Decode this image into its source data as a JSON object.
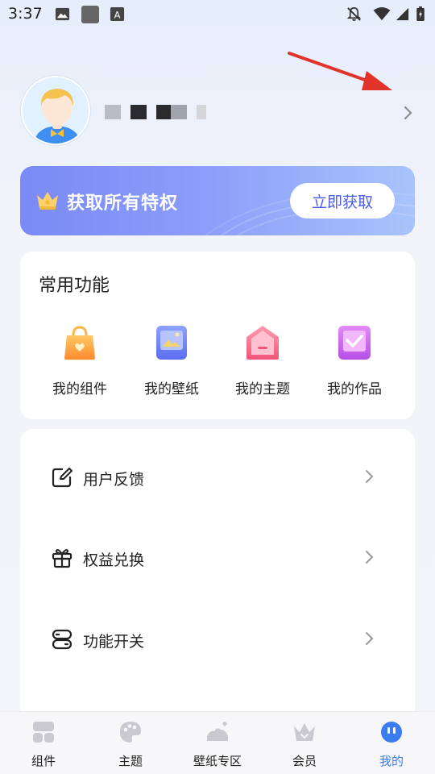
{
  "status_bar": {
    "time": "3:37",
    "left_icons": [
      "image-icon",
      "square-app-icon",
      "font-a-icon"
    ],
    "right_icons": [
      "bell-off-icon",
      "wifi-icon",
      "signal-icon",
      "battery-charging-icon"
    ]
  },
  "profile": {
    "avatar_icon": "avatar-boy-icon"
  },
  "vip": {
    "text": "获取所有特权",
    "button": "立即获取",
    "icon": "crown-icon"
  },
  "common": {
    "title": "常用功能",
    "items": [
      {
        "label": "我的组件",
        "icon": "bag-icon"
      },
      {
        "label": "我的壁纸",
        "icon": "picture-icon"
      },
      {
        "label": "我的主题",
        "icon": "house-icon"
      },
      {
        "label": "我的作品",
        "icon": "check-box-icon"
      }
    ]
  },
  "menu": {
    "items": [
      {
        "label": "用户反馈",
        "icon": "edit-icon"
      },
      {
        "label": "权益兑换",
        "icon": "gift-icon"
      },
      {
        "label": "功能开关",
        "icon": "toggle-icon"
      }
    ]
  },
  "nav": {
    "items": [
      {
        "label": "组件",
        "icon": "widgets-icon"
      },
      {
        "label": "主题",
        "icon": "palette-icon"
      },
      {
        "label": "壁纸专区",
        "icon": "landscape-icon"
      },
      {
        "label": "会员",
        "icon": "crown-icon"
      },
      {
        "label": "我的",
        "icon": "robot-face-icon"
      }
    ],
    "active": "我的"
  },
  "colors": {
    "accent": "#3c7cf2",
    "vip_start": "#7a8af6",
    "vip_end": "#a9c4fb",
    "arrow": "#e0342b"
  }
}
